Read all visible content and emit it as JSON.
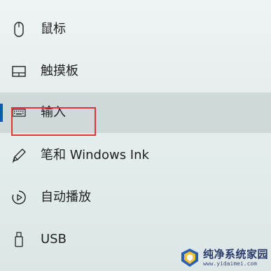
{
  "nav": {
    "items": [
      {
        "label": "鼠标",
        "icon": "mouse-icon",
        "selected": false
      },
      {
        "label": "触摸板",
        "icon": "touchpad-icon",
        "selected": false
      },
      {
        "label": "输入",
        "icon": "keyboard-icon",
        "selected": true
      },
      {
        "label": "笔和 Windows Ink",
        "icon": "pen-icon",
        "selected": false
      },
      {
        "label": "自动播放",
        "icon": "autoplay-icon",
        "selected": false
      },
      {
        "label": "USB",
        "icon": "usb-icon",
        "selected": false
      }
    ]
  },
  "colors": {
    "accent": "#0b5cad",
    "highlight_border": "#e4343a",
    "selected_bg": "#c8d0d0"
  },
  "watermark": {
    "title": "纯净系统家园",
    "url": "www.yidaimei.com"
  }
}
